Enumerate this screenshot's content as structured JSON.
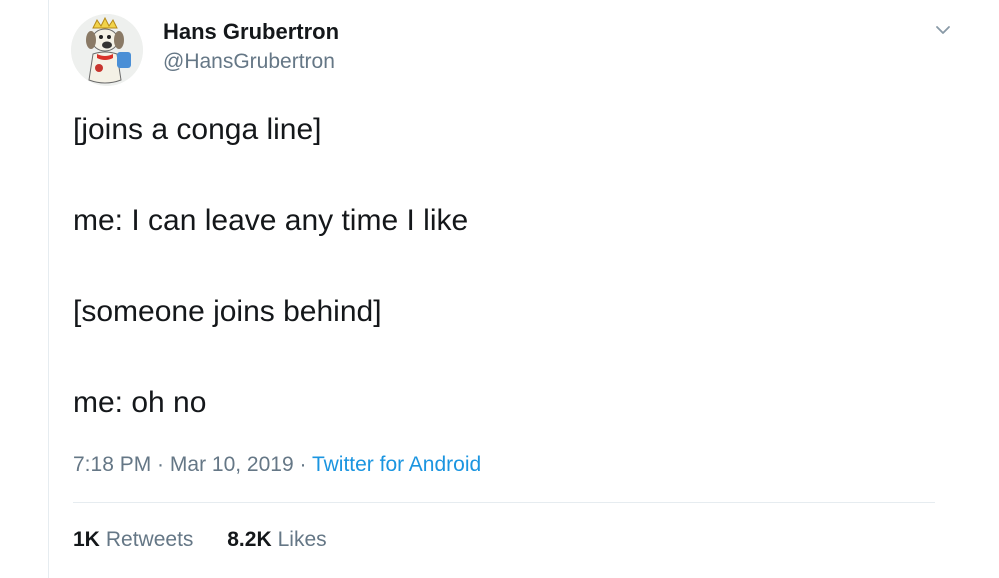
{
  "author": {
    "display_name": "Hans Grubertron",
    "handle": "@HansGrubertron",
    "avatar_icon": "cartoon-dog-avatar"
  },
  "menu": {
    "icon": "chevron-down-icon"
  },
  "tweet": {
    "lines": [
      "[joins a conga line]",
      "me: I can leave any time I like",
      "[someone joins behind]",
      "me: oh no"
    ]
  },
  "meta": {
    "time": "7:18 PM",
    "separator1": " · ",
    "date": "Mar 10, 2019",
    "separator2": " · ",
    "source": "Twitter for Android"
  },
  "stats": {
    "retweets_count": "1K",
    "retweets_label": "Retweets",
    "likes_count": "8.2K",
    "likes_label": "Likes"
  },
  "colors": {
    "text": "#14171a",
    "muted": "#657786",
    "link": "#1b95e0",
    "divider": "#e6ecf0"
  }
}
